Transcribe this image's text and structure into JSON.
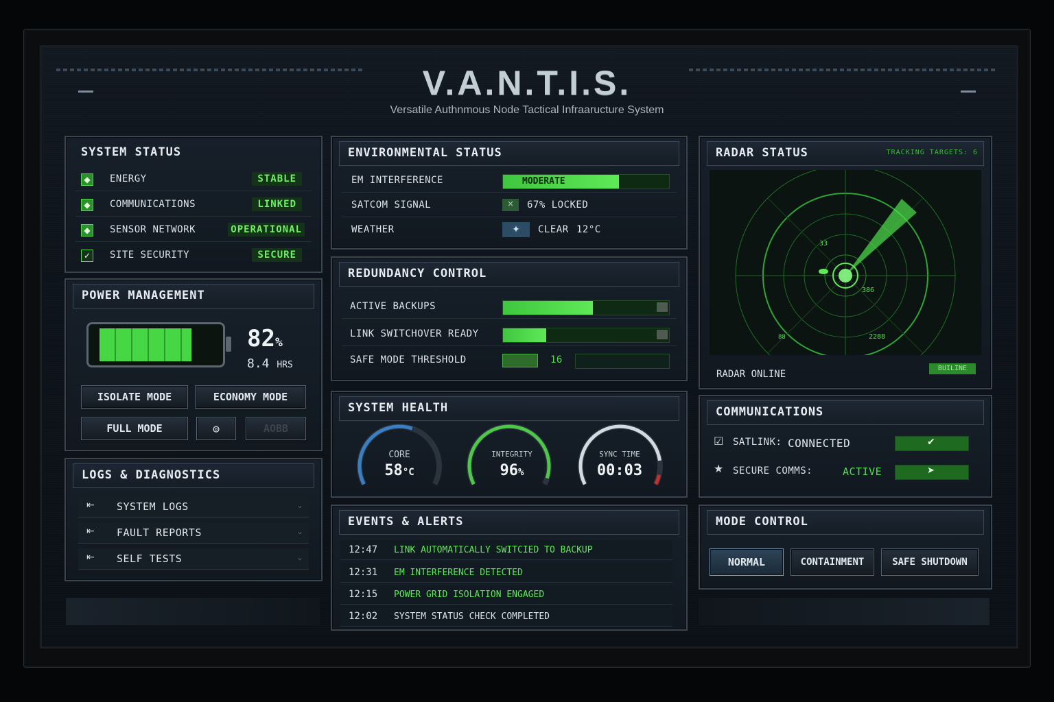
{
  "header": {
    "title": "V.A.N.T.I.S.",
    "subtitle": "Versatile Authnmous Node Tactical Infraaructure System"
  },
  "system_status": {
    "title": "SYSTEM STATUS",
    "items": [
      {
        "label": "ENERGY",
        "value": "STABLE"
      },
      {
        "label": "COMMUNICATIONS",
        "value": "LINKED"
      },
      {
        "label": "SENSOR NETWORK",
        "value": "OPERATIONAL"
      },
      {
        "label": "SITE SECURITY",
        "value": "SECURE"
      }
    ]
  },
  "power": {
    "title": "POWER MANAGEMENT",
    "percent_value": "82",
    "percent_unit": "%",
    "hours_value": "8.4",
    "hours_unit": "HRS",
    "battery_fill": 0.82,
    "buttons": {
      "isolate": "ISOLATE MODE",
      "economy": "ECONOMY MODE",
      "full": "FULL MODE",
      "extra": "AOBB"
    }
  },
  "logs": {
    "title": "LOGS & DIAGNOSTICS",
    "items": [
      "SYSTEM LOGS",
      "FAULT REPORTS",
      "SELF TESTS"
    ]
  },
  "environment": {
    "title": "ENVIRONMENTAL STATUS",
    "rows": [
      {
        "label": "EM INTERFERENCE",
        "value": "MODERATE"
      },
      {
        "label": "SATCOM SIGNAL",
        "value": "67% LOCKED"
      },
      {
        "label": "WEATHER",
        "value": "CLEAR",
        "temp": "12°C"
      }
    ]
  },
  "redundancy": {
    "title": "REDUNDANCY CONTROL",
    "rows": [
      {
        "label": "ACTIVE BACKUPS"
      },
      {
        "label": "LINK SWITCHOVER READY"
      },
      {
        "label": "SAFE MODE THRESHOLD",
        "value": "16"
      }
    ]
  },
  "health": {
    "title": "SYSTEM HEALTH",
    "gauges": [
      {
        "label": "CORE",
        "value": "58",
        "unit": "°C",
        "level": 0.58
      },
      {
        "label": "INTEGRITY",
        "value": "96",
        "unit": "%",
        "level": 0.96
      },
      {
        "label": "SYNC TIME",
        "value": "00:03",
        "unit": "",
        "level": 0.85
      }
    ]
  },
  "events": {
    "title": "EVENTS & ALERTS",
    "items": [
      {
        "time": "12:47",
        "msg": "LINK AUTOMATICALLY SWITCIED TO BACKUP",
        "color": "#5fe957"
      },
      {
        "time": "12:31",
        "msg": "EM INTERFERENCE DETECTED",
        "color": "#5fe957"
      },
      {
        "time": "12:15",
        "msg": "POWER GRID ISOLATION ENGAGED",
        "color": "#5fe957"
      },
      {
        "time": "12:02",
        "msg": "SYSTEM STATUS CHECK COMPLETED",
        "color": "#dbe3e8"
      }
    ]
  },
  "radar": {
    "title": "RADAR STATUS",
    "tracking": "TRACKING TARGETS: 6",
    "status": "RADAR ONLINE",
    "badge": "BUILINE"
  },
  "comms": {
    "title": "COMMUNICATIONS",
    "satlink_label": "SATLINK:",
    "satlink_value": "CONNECTED",
    "secure_label": "SECURE COMMS:",
    "secure_value": "ACTIVE"
  },
  "mode": {
    "title": "MODE CONTROL",
    "buttons": [
      "NORMAL",
      "CONTAINMENT",
      "SAFE SHUTDOWN"
    ]
  },
  "colors": {
    "accent": "#4fe04b",
    "panel": "#151d26",
    "border": "#3b4550"
  }
}
